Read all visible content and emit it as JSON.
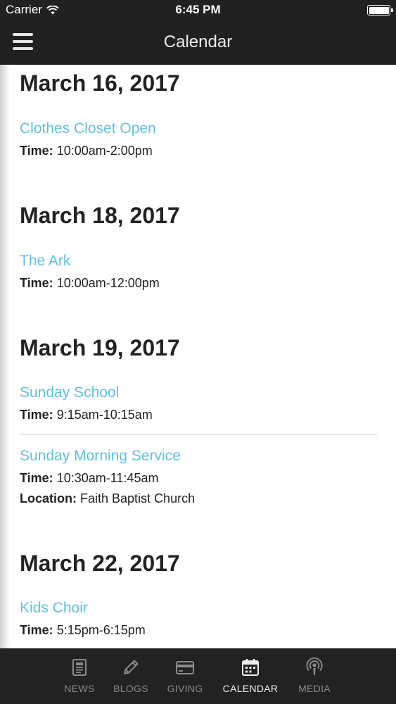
{
  "status_bar": {
    "carrier": "Carrier",
    "time": "6:45 PM"
  },
  "nav": {
    "title": "Calendar"
  },
  "events": {
    "day1": {
      "date": "March 16, 2017",
      "items": [
        {
          "title": "Clothes Closet Open",
          "time_label": "Time:",
          "time": "10:00am-2:00pm"
        }
      ]
    },
    "day2": {
      "date": "March 18, 2017",
      "items": [
        {
          "title": "The Ark",
          "time_label": "Time:",
          "time": "10:00am-12:00pm"
        }
      ]
    },
    "day3": {
      "date": "March 19, 2017",
      "items": [
        {
          "title": "Sunday School",
          "time_label": "Time:",
          "time": "9:15am-10:15am"
        },
        {
          "title": "Sunday Morning Service",
          "time_label": "Time:",
          "time": "10:30am-11:45am",
          "location_label": "Location:",
          "location": "Faith Baptist Church"
        }
      ]
    },
    "day4": {
      "date": "March 22, 2017",
      "items": [
        {
          "title": "Kids Choir",
          "time_label": "Time:",
          "time": "5:15pm-6:15pm"
        }
      ]
    }
  },
  "tabs": [
    {
      "label": "NEWS",
      "icon": "news-icon",
      "active": false
    },
    {
      "label": "BLOGS",
      "icon": "pencil-icon",
      "active": false
    },
    {
      "label": "GIVING",
      "icon": "credit-card-icon",
      "active": false
    },
    {
      "label": "CALENDAR",
      "icon": "calendar-icon",
      "active": true
    },
    {
      "label": "MEDIA",
      "icon": "podcast-icon",
      "active": false
    }
  ],
  "colors": {
    "bar_background": "#212121",
    "event_link": "#5fc1e0",
    "tab_inactive": "#8a8a8a",
    "tab_active": "#eeeeee"
  }
}
